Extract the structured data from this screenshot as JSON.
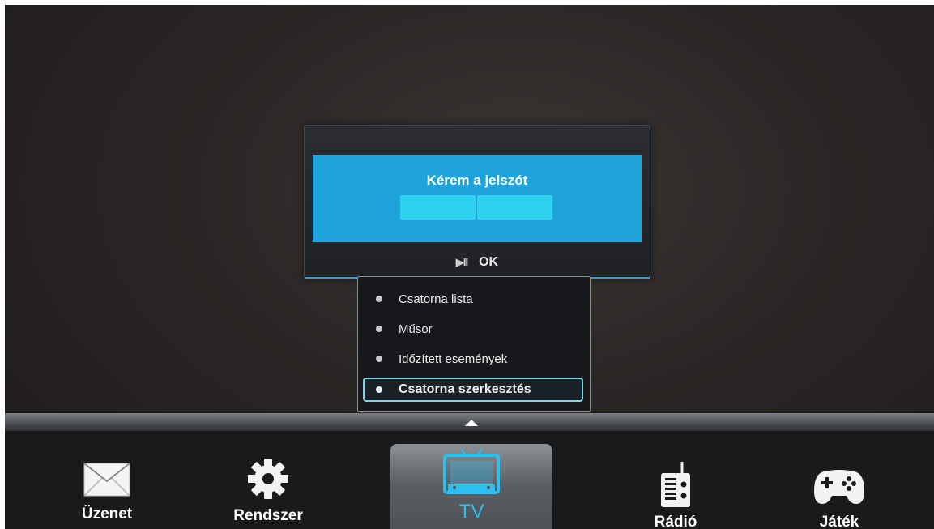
{
  "dialog": {
    "prompt": "Kérem a jelszót",
    "footer_icon_glyph": "▶II",
    "ok_label": "OK"
  },
  "popup_menu": {
    "items": [
      {
        "label": "Csatorna lista"
      },
      {
        "label": "Műsor"
      },
      {
        "label": "Időzített események"
      },
      {
        "label": "Csatorna szerkesztés",
        "selected": true
      }
    ]
  },
  "bottom_nav": {
    "items": [
      {
        "label": "Üzenet",
        "icon": "envelope-icon"
      },
      {
        "label": "Rendszer",
        "icon": "gear-icon"
      },
      {
        "label": "TV",
        "icon": "tv-icon",
        "selected": true
      },
      {
        "label": "Rádió",
        "icon": "radio-icon"
      },
      {
        "label": "Játék",
        "icon": "gamepad-icon"
      }
    ]
  },
  "colors": {
    "accent": "#1ea3db",
    "field": "#2fd2ee",
    "selected_label": "#2dbff0"
  }
}
